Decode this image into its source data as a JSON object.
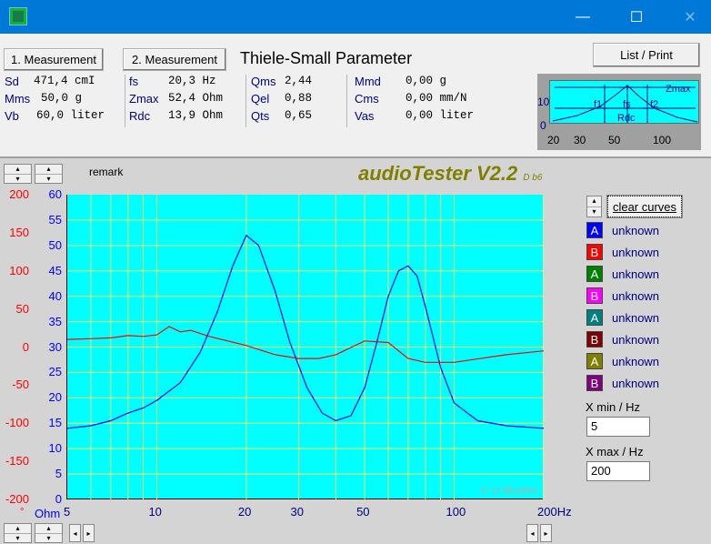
{
  "window": {
    "minimize": "—",
    "maximize": "☐",
    "close": "✕"
  },
  "header": {
    "measurement1": "1. Measurement",
    "measurement2": "2. Measurement",
    "title": "Thiele-Small Parameter",
    "list_print": "List / Print"
  },
  "params": {
    "col1": [
      {
        "label": "Sd",
        "value": "471,4 cmI"
      },
      {
        "label": "Mms",
        "value": "50,0 g"
      },
      {
        "label": "Vb",
        "value": "60,0 liter"
      }
    ],
    "col2": [
      {
        "label": "fs",
        "value": "20,3 Hz"
      },
      {
        "label": "Zmax",
        "value": "52,4 Ohm"
      },
      {
        "label": "Rdc",
        "value": "13,9 Ohm"
      }
    ],
    "col3": [
      {
        "label": "Qms",
        "value": "2,44"
      },
      {
        "label": "Qel",
        "value": "0,88"
      },
      {
        "label": "Qts",
        "value": "0,65"
      }
    ],
    "col4": [
      {
        "label": "Mmd",
        "value": "0,00 g"
      },
      {
        "label": "Cms",
        "value": "0,00 mm/N"
      },
      {
        "label": "Vas",
        "value": "0,00 liter"
      }
    ]
  },
  "mini_plot": {
    "y_tick_top": "10",
    "y_tick_bottom": "0",
    "x_ticks": [
      "20",
      "30",
      "50",
      "100"
    ],
    "labels": {
      "f1": "f1",
      "fs": "fs",
      "f2": "f2",
      "zmax": "Zmax",
      "rdc": "Rdc"
    }
  },
  "main": {
    "remark": "remark",
    "brand": "audioTester V2.2",
    "brand_version": "D b6",
    "watermark": "© U.Mueller",
    "red_axis_ticks": [
      "200",
      "150",
      "100",
      "50",
      "0",
      "-50",
      "-100",
      "-150",
      "-200"
    ],
    "blue_axis_ticks": [
      "60",
      "55",
      "50",
      "45",
      "40",
      "35",
      "30",
      "25",
      "20",
      "15",
      "10",
      "5",
      "0"
    ],
    "axis_unit_red": "°",
    "axis_unit_blue": "Ohm",
    "x_ticks": [
      "5",
      "10",
      "20",
      "30",
      "50",
      "100",
      "200Hz"
    ],
    "clear_curves": "clear curves",
    "legend": [
      {
        "letter": "A",
        "label": "unknown",
        "color": "#0000ff"
      },
      {
        "letter": "B",
        "label": "unknown",
        "color": "#ff0000"
      },
      {
        "letter": "A",
        "label": "unknown",
        "color": "#008000"
      },
      {
        "letter": "B",
        "label": "unknown",
        "color": "#ff00ff"
      },
      {
        "letter": "A",
        "label": "unknown",
        "color": "#008080"
      },
      {
        "letter": "B",
        "label": "unknown",
        "color": "#800000"
      },
      {
        "letter": "A",
        "label": "unknown",
        "color": "#808000"
      },
      {
        "letter": "B",
        "label": "unknown",
        "color": "#800080"
      }
    ],
    "xmin_label": "X min / Hz",
    "xmin_value": "5",
    "xmax_label": "X max / Hz",
    "xmax_value": "200"
  },
  "chart_data": {
    "type": "line",
    "x_scale": "log",
    "xlim": [
      5,
      200
    ],
    "ylim_impedance": [
      0,
      60
    ],
    "ylim_phase": [
      -200,
      200
    ],
    "series": [
      {
        "color": "#0000ff",
        "x": [
          5,
          6,
          7,
          8,
          9,
          10,
          12,
          14,
          16,
          18,
          20,
          22,
          25,
          28,
          32,
          36,
          40,
          45,
          50,
          55,
          60,
          65,
          70,
          75,
          80,
          90,
          100,
          120,
          150,
          200
        ],
        "values": [
          14,
          14.5,
          15.5,
          17,
          18,
          19.5,
          23,
          29,
          37,
          46,
          52,
          50,
          41,
          31,
          22,
          17,
          15.5,
          16.5,
          22,
          31,
          40,
          45,
          46,
          44,
          38,
          26,
          19,
          15.5,
          14.5,
          14
        ]
      },
      {
        "color": "#ff0000",
        "x": [
          5,
          6,
          7,
          8,
          9,
          10,
          11,
          12,
          13,
          15,
          20,
          25,
          30,
          35,
          40,
          50,
          60,
          70,
          80,
          100,
          150,
          200
        ],
        "values": [
          10,
          11,
          12,
          15,
          14,
          16,
          27,
          20,
          22,
          14,
          2,
          -10,
          -15,
          -15,
          -10,
          8,
          6,
          -15,
          -20,
          -20,
          -10,
          -5
        ]
      }
    ]
  }
}
